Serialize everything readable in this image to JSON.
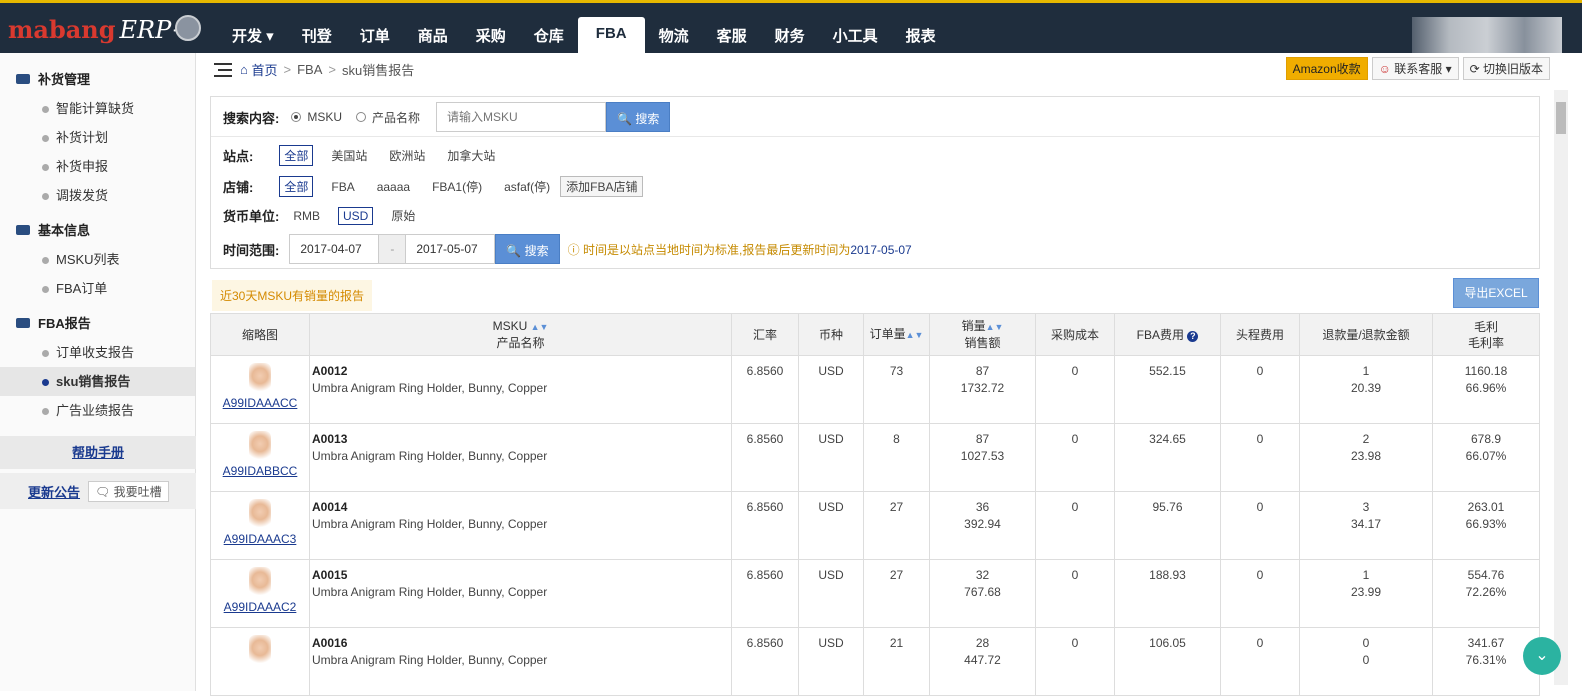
{
  "brand": {
    "logo_main": "mabang",
    "logo_suffix": "ERP+"
  },
  "nav": [
    "开发 ▾",
    "刊登",
    "订单",
    "商品",
    "采购",
    "仓库",
    "FBA",
    "物流",
    "客服",
    "财务",
    "小工具",
    "报表"
  ],
  "nav_active_index": 6,
  "sidebar": {
    "groups": [
      {
        "title": "补货管理",
        "items": [
          "智能计算缺货",
          "补货计划",
          "补货申报",
          "调拨发货"
        ]
      },
      {
        "title": "基本信息",
        "items": [
          "MSKU列表",
          "FBA订单"
        ]
      },
      {
        "title": "FBA报告",
        "items": [
          "订单收支报告",
          "sku销售报告",
          "广告业绩报告"
        ]
      }
    ],
    "active_item": "sku销售报告",
    "help": "帮助手册",
    "notice": "更新公告",
    "feedback": "我要吐槽"
  },
  "breadcrumb": {
    "home": "首页",
    "level1": "FBA",
    "current": "sku销售报告"
  },
  "top_buttons": {
    "amazon": "Amazon收款",
    "contact": "联系客服 ▾",
    "switch": "切换旧版本"
  },
  "filter": {
    "search_label": "搜索内容:",
    "radio_msku": "MSKU",
    "radio_product": "产品名称",
    "search_placeholder": "请输入MSKU",
    "search_btn": "搜索",
    "site_label": "站点:",
    "sites": [
      "全部",
      "美国站",
      "欧洲站",
      "加拿大站"
    ],
    "store_label": "店铺:",
    "stores": [
      "全部",
      "FBA",
      "aaaaa",
      "FBA1(停)",
      "asfaf(停)"
    ],
    "add_store": "添加FBA店铺",
    "currency_label": "货币单位:",
    "currencies": [
      "RMB",
      "USD",
      "原始"
    ],
    "time_label": "时间范围:",
    "date_from": "2017-04-07",
    "date_sep": "-",
    "date_to": "2017-05-07",
    "time_tip": "时间是以站点当地时间为标准,报告最后更新时间为",
    "time_tip_date": "2017-05-07"
  },
  "recent_label": "近30天MSKU有销量的报告",
  "export_label": "导出EXCEL",
  "table": {
    "headers": {
      "thumb": "缩略图",
      "msku": "MSKU",
      "product": "产品名称",
      "rate": "汇率",
      "currency": "币种",
      "orders": "订单量",
      "sales": "销量",
      "sales_amount": "销售额",
      "purchase": "采购成本",
      "fba_fee": "FBA费用",
      "head_fee": "头程费用",
      "refund": "退款量/退款金额",
      "profit": "毛利",
      "margin": "毛利率"
    },
    "rows": [
      {
        "asin": "A99IDAAACC",
        "msku": "A0012",
        "name": "Umbra Anigram Ring Holder, Bunny, Copper",
        "rate": "6.8560",
        "cur": "USD",
        "orders": "73",
        "qty": "87",
        "amount": "1732.72",
        "purchase": "0",
        "fba": "552.15",
        "head": "0",
        "refund_qty": "1",
        "refund_amt": "20.39",
        "profit": "1160.18",
        "margin": "66.96%"
      },
      {
        "asin": "A99IDABBCC",
        "msku": "A0013",
        "name": "Umbra Anigram Ring Holder, Bunny, Copper",
        "rate": "6.8560",
        "cur": "USD",
        "orders": "8",
        "qty": "87",
        "amount": "1027.53",
        "purchase": "0",
        "fba": "324.65",
        "head": "0",
        "refund_qty": "2",
        "refund_amt": "23.98",
        "profit": "678.9",
        "margin": "66.07%"
      },
      {
        "asin": "A99IDAAAC3",
        "msku": "A0014",
        "name": "Umbra Anigram Ring Holder, Bunny, Copper",
        "rate": "6.8560",
        "cur": "USD",
        "orders": "27",
        "qty": "36",
        "amount": "392.94",
        "purchase": "0",
        "fba": "95.76",
        "head": "0",
        "refund_qty": "3",
        "refund_amt": "34.17",
        "profit": "263.01",
        "margin": "66.93%"
      },
      {
        "asin": "A99IDAAAC2",
        "msku": "A0015",
        "name": "Umbra Anigram Ring Holder, Bunny, Copper",
        "rate": "6.8560",
        "cur": "USD",
        "orders": "27",
        "qty": "32",
        "amount": "767.68",
        "purchase": "0",
        "fba": "188.93",
        "head": "0",
        "refund_qty": "1",
        "refund_amt": "23.99",
        "profit": "554.76",
        "margin": "72.26%"
      },
      {
        "asin": "",
        "msku": "A0016",
        "name": "Umbra Anigram Ring Holder, Bunny, Copper",
        "rate": "6.8560",
        "cur": "USD",
        "orders": "21",
        "qty": "28",
        "amount": "447.72",
        "purchase": "0",
        "fba": "106.05",
        "head": "0",
        "refund_qty": "0",
        "refund_amt": "0",
        "profit": "341.67",
        "margin": "76.31%"
      }
    ]
  },
  "colors": {
    "topbar": "#1f2d3d",
    "accent": "#1a3a8f",
    "button": "#5b8fd6",
    "amazon": "#f0ad00"
  }
}
